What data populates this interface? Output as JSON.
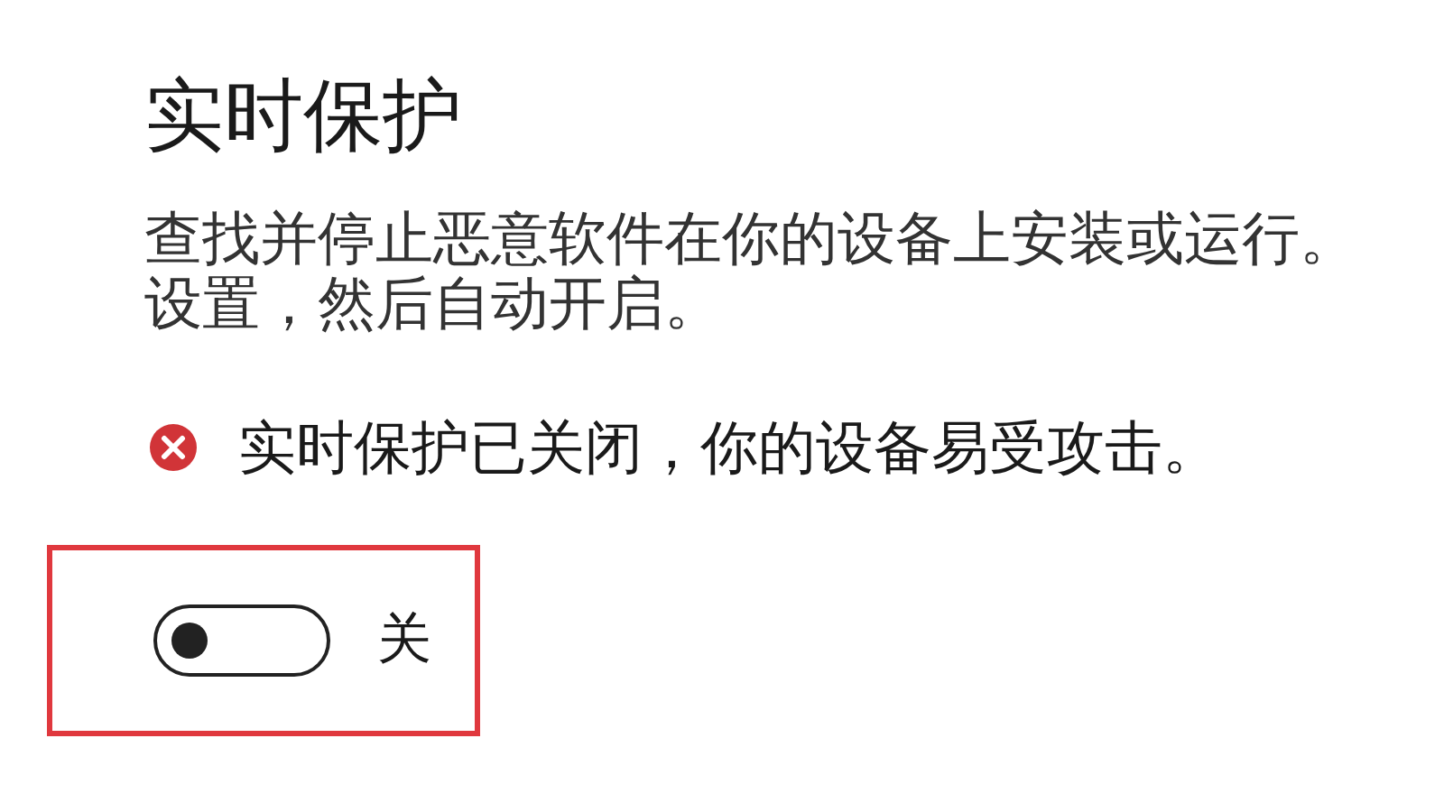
{
  "section": {
    "title": "实时保护",
    "description": [
      "查找并停止恶意软件在你的设备上安装或运行。",
      "设置，然后自动开启。"
    ],
    "alert": {
      "kind": "error",
      "text": "实时保护已关闭，你的设备易受攻击。"
    },
    "toggle": {
      "on": false,
      "label": "关",
      "highlighted": true
    }
  }
}
